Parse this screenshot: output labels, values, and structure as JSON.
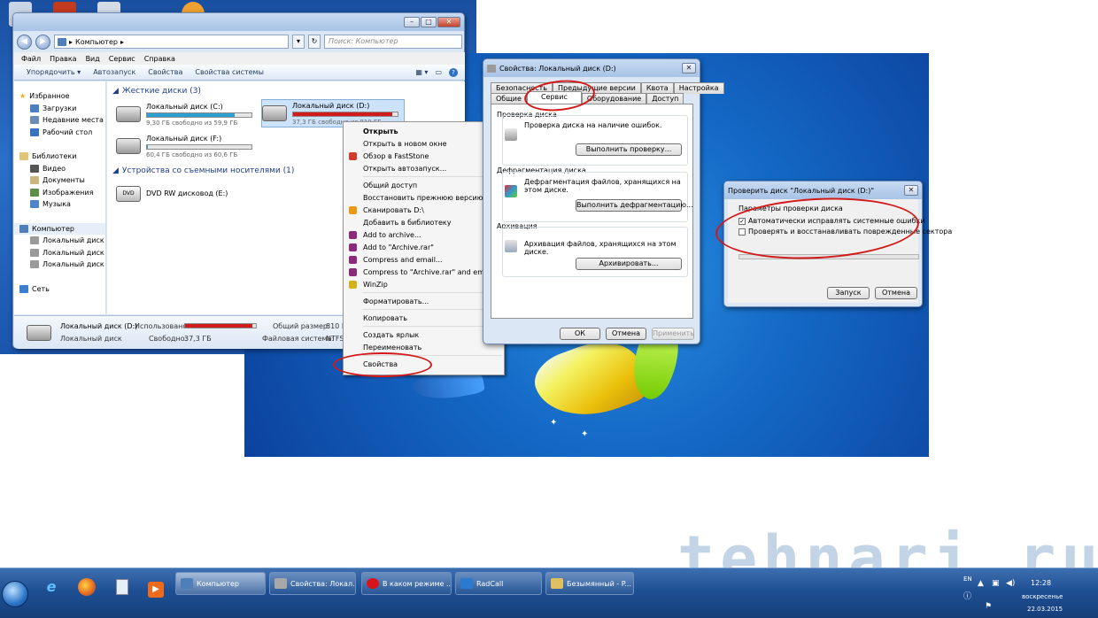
{
  "explorer": {
    "address": "Компьютер",
    "search_placeholder": "Поиск: Компьютер",
    "menu": [
      "Файл",
      "Правка",
      "Вид",
      "Сервис",
      "Справка"
    ],
    "toolbar": [
      "Упорядочить ▾",
      "Автозапуск",
      "Свойства",
      "Свойства системы"
    ],
    "nav": {
      "favorites": "Избранное",
      "favorites_items": [
        "Загрузки",
        "Недавние места",
        "Рабочий стол"
      ],
      "libraries": "Библиотеки",
      "libraries_items": [
        "Видео",
        "Документы",
        "Изображения",
        "Музыка"
      ],
      "computer": "Компьютер",
      "computer_items": [
        "Локальный диск (C",
        "Локальный диск (D",
        "Локальный диск (F"
      ],
      "network": "Сеть"
    },
    "hard_disks_header": "Жесткие диски (3)",
    "drives": [
      {
        "name": "Локальный диск (C:)",
        "free": "9,30 ГБ свободно из 59,9 ГБ",
        "used_fraction": 0.84
      },
      {
        "name": "Локальный диск (D:)",
        "free": "37,3 ГБ свободно из 810 ГБ",
        "used_fraction": 0.95
      },
      {
        "name": "Локальный диск (F:)",
        "free": "60,4 ГБ свободно из 60,6 ГБ",
        "used_fraction": 0.01
      }
    ],
    "removable_header": "Устройства со съемными носителями (1)",
    "dvd": "DVD RW дисковод (E:)",
    "dvd_badge": "DVD",
    "status": {
      "name": "Локальный диск (D:)",
      "type": "Локальный диск",
      "used_label": "Использовано:",
      "free_label": "Свободно:",
      "free_value": "37,3 ГБ",
      "total_label": "Общий размер:",
      "total_value": "810 ГБ",
      "fs_label": "Файловая система:",
      "fs_value": "NTFS"
    }
  },
  "context_menu": [
    {
      "label": "Открыть",
      "bold": true
    },
    {
      "label": "Открыть в новом окне"
    },
    {
      "label": "Обзор в FastStone",
      "icon": "#d23b2b"
    },
    {
      "label": "Открыть автозапуск..."
    },
    {
      "sep": true
    },
    {
      "label": "Общий доступ",
      "arrow": true
    },
    {
      "label": "Восстановить прежнюю версию"
    },
    {
      "label": "Сканировать D:\\",
      "icon": "#e89a17"
    },
    {
      "label": "Добавить в библиотеку",
      "arrow": true
    },
    {
      "label": "Add to archive...",
      "icon": "#8b2a7a"
    },
    {
      "label": "Add to \"Archive.rar\"",
      "icon": "#8b2a7a"
    },
    {
      "label": "Compress and email...",
      "icon": "#8b2a7a"
    },
    {
      "label": "Compress to \"Archive.rar\" and email",
      "icon": "#8b2a7a"
    },
    {
      "label": "WinZip",
      "arrow": true,
      "icon": "#d4b21a"
    },
    {
      "sep": true
    },
    {
      "label": "Форматировать..."
    },
    {
      "sep": true
    },
    {
      "label": "Копировать"
    },
    {
      "sep": true
    },
    {
      "label": "Создать ярлык"
    },
    {
      "label": "Переименовать"
    },
    {
      "sep": true
    },
    {
      "label": "Свойства"
    }
  ],
  "props": {
    "title": "Свойства: Локальный диск (D:)",
    "tabs_top": [
      "Безопасность",
      "Предыдущие версии",
      "Квота",
      "Настройка"
    ],
    "tabs_bottom": [
      "Общие",
      "Сервис",
      "Оборудование",
      "Доступ"
    ],
    "sections": [
      {
        "title": "Проверка диска",
        "text": "Проверка диска на наличие ошибок.",
        "button": "Выполнить проверку..."
      },
      {
        "title": "Дефрагментация диска",
        "text": "Дефрагментация файлов, хранящихся на этом диске.",
        "button": "Выполнить дефрагментацию..."
      },
      {
        "title": "Архивация",
        "text": "Архивация файлов, хранящихся на этом диске.",
        "button": "Архивировать..."
      }
    ],
    "ok": "ОК",
    "cancel": "Отмена",
    "apply": "Применить"
  },
  "chkdsk": {
    "title": "Проверить диск \"Локальный диск (D:)\"",
    "group": "Параметры проверки диска",
    "option1": "Автоматически исправлять системные ошибки",
    "option1_checked": true,
    "option2": "Проверять и восстанавливать поврежденные сектора",
    "option2_checked": false,
    "start": "Запуск",
    "cancel": "Отмена"
  },
  "taskbar": {
    "tasks": [
      "Компьютер",
      "Свойства: Локал...",
      "В каком режиме ...",
      "RadCall",
      "Безымянный - P..."
    ],
    "lang": "EN",
    "time": "12:28",
    "day": "воскресенье",
    "date": "22.03.2015"
  },
  "watermark": "tehnari.ru",
  "colors": {
    "accent_red": "#d11a1a",
    "bar_blue": "#2a9fd0",
    "bar_red": "#d01c1c"
  }
}
